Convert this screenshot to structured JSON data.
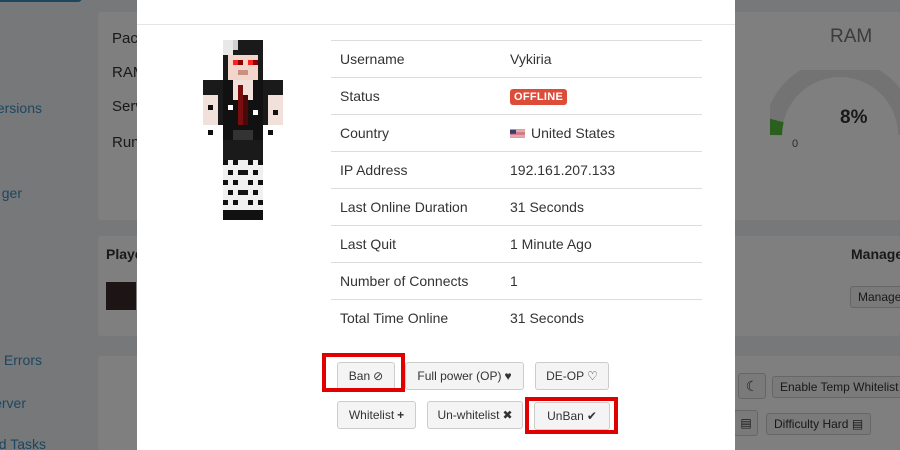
{
  "background": {
    "sidebar_items": [
      "ersions",
      "ger",
      "Errors",
      "erver",
      "d Tasks"
    ],
    "info_labels": [
      "Pac",
      "RAM",
      "Serv",
      "Run"
    ],
    "ram": {
      "title": "RAM",
      "value": "8%",
      "zero_label": "0"
    },
    "players_header": "Playe",
    "manage_header": "Manage",
    "manage_button": "Manage",
    "enable_temp_whitelist": "Enable Temp Whitelist",
    "difficulty": "Difficulty Hard"
  },
  "modal": {
    "rows": [
      {
        "label": "Username",
        "value": "Vykiria"
      },
      {
        "label": "Status",
        "value": "OFFLINE",
        "badge_color": "#dd4b39"
      },
      {
        "label": "Country",
        "value": "United States",
        "flag": "us-flag-icon"
      },
      {
        "label": "IP Address",
        "value": "192.161.207.133"
      },
      {
        "label": "Last Online Duration",
        "value": "31 Seconds"
      },
      {
        "label": "Last Quit",
        "value": "1 Minute Ago"
      },
      {
        "label": "Number of Connects",
        "value": "1"
      },
      {
        "label": "Total Time Online",
        "value": "31 Seconds"
      }
    ],
    "buttons": {
      "ban": "Ban",
      "full_power": "Full power (OP)",
      "deop": "DE-OP",
      "whitelist": "Whitelist",
      "unwhitelist": "Un-whitelist",
      "unban": "UnBan"
    },
    "highlight_color": "#e00000"
  }
}
